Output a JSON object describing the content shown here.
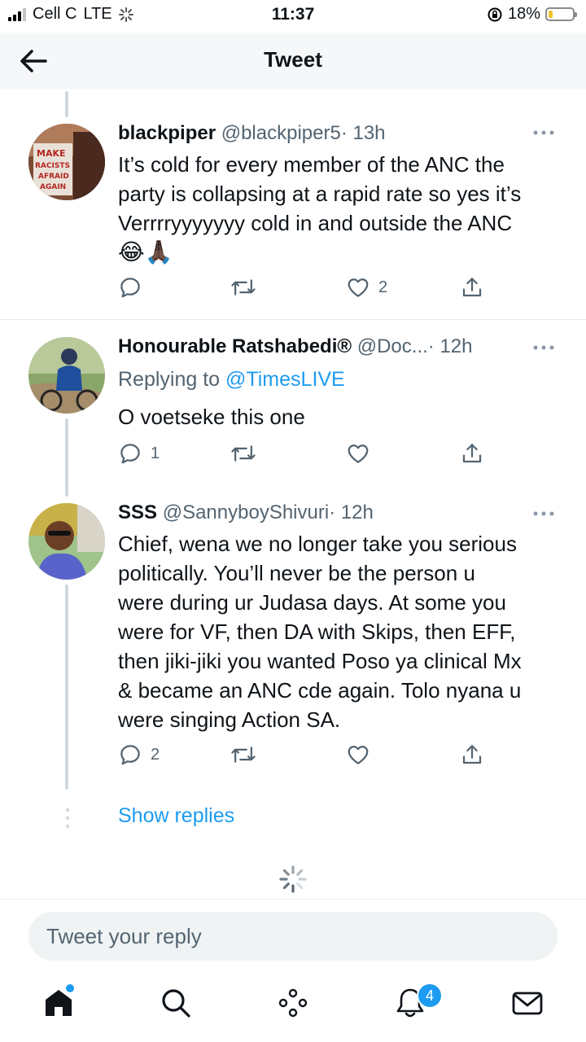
{
  "status": {
    "carrier": "Cell C",
    "network": "LTE",
    "time": "11:37",
    "battery": "18%",
    "battery_level": 0.18,
    "accent": "#1d9bf0"
  },
  "header": {
    "title": "Tweet"
  },
  "tweets": [
    {
      "name": "blackpiper",
      "handle": "@blackpiper5",
      "time": "· 13h",
      "text_lines": [
        "It’s cold for every member of the ANC the",
        "party is collapsing at a rapid rate so yes it’s",
        "Verrrryyyyyyy cold in and outside the ANC",
        "😂🙏🏿"
      ],
      "replies": "",
      "likes": "2",
      "avatar_text": "MAKE RACISTS AFRAID AGAIN"
    },
    {
      "name": "Honourable Ratshabedi®",
      "handle": "@Doc...",
      "time": "· 12h",
      "replying_prefix": "Replying to",
      "replying_to": "@TimesLIVE",
      "text_lines": [
        "O voetseke this one"
      ],
      "replies": "1",
      "likes": ""
    },
    {
      "name": "SSS",
      "handle": "@SannyboyShivuri",
      "time": "· 12h",
      "text_lines": [
        "Chief, wena we no longer take you serious",
        "politically. You’ll never be the person u",
        "were during ur Judasa days. At some you",
        "were for VF, then DA with Skips, then EFF,",
        "then jiki-jiki you wanted Poso ya clinical Mx",
        "& became an ANC cde again. Tolo nyana u",
        "were singing Action SA."
      ],
      "replies": "2",
      "likes": ""
    }
  ],
  "show_replies": "Show replies",
  "reply_box": {
    "placeholder": "Tweet your reply"
  },
  "nav": {
    "notifications_count": "4"
  }
}
